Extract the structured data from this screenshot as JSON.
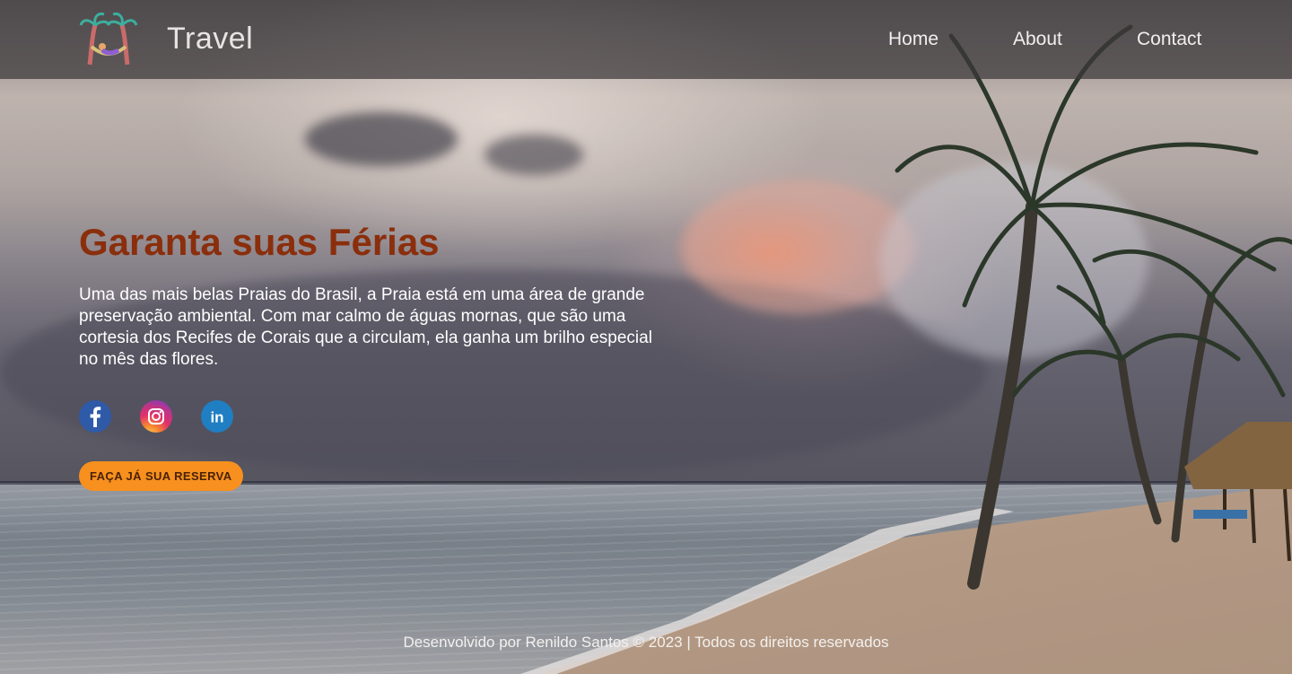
{
  "header": {
    "brand": "Travel",
    "logo_icon": "palm-hammock-logo",
    "nav": [
      {
        "label": "Home"
      },
      {
        "label": "About"
      },
      {
        "label": "Contact"
      }
    ]
  },
  "hero": {
    "title": "Garanta suas Férias",
    "description": "Uma das mais belas Praias do Brasil, a Praia está em uma área de grande preservação ambiental. Com mar calmo de águas mornas, que são uma cortesia dos Recifes de Corais que a circulam, ela ganha um brilho especial no mês das flores.",
    "social": [
      {
        "icon": "facebook-icon",
        "color": "#2f5aa8"
      },
      {
        "icon": "instagram-icon",
        "color": "#e1306c"
      },
      {
        "icon": "linkedin-icon",
        "color": "#1f7fc2"
      }
    ],
    "cta_label": "FAÇA JÁ SUA RESERVA",
    "title_color": "#8a2e0c",
    "cta_color": "#f7901e"
  },
  "footer": {
    "text": "Desenvolvido por Renildo Santos © 2023 | Todos os direitos reservados"
  }
}
